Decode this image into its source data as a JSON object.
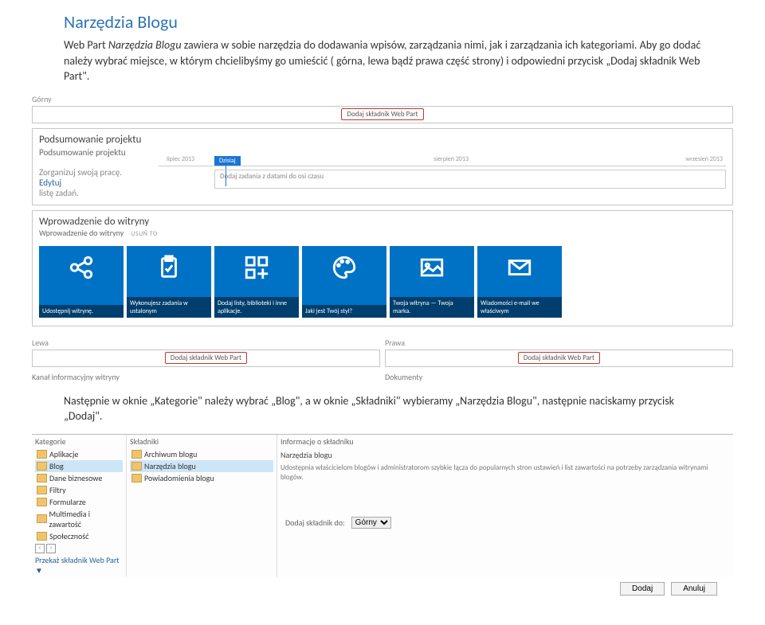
{
  "doc": {
    "title": "Narzędzia Blogu",
    "para1_a": "Web Part ",
    "para1_b": "Narzędzia Blogu",
    "para1_c": " zawiera w sobie narzędzia do dodawania wpisów, zarządzania nimi, jak i zarządzania ich kategoriami. Aby go dodać należy wybrać miejsce, w którym chcielibyśmy go umieścić ( górna, lewa bądź prawa część strony) i odpowiedni przycisk „Dodaj składnik Web Part\".",
    "para2": "Następnie w oknie „Kategorie\" należy wybrać „Blog\", a w oknie „Składniki\" wybieramy „Narzędzia Blogu\", następnie naciskamy przycisk „Dodaj\"."
  },
  "shot1": {
    "zoneTop": "Górny",
    "zoneLeft": "Lewa",
    "zoneRight": "Prawa",
    "addWp": "Dodaj składnik Web Part",
    "summaryTitle": "Podsumowanie projektu",
    "summarySub": "Podsumowanie projektu",
    "tl_organize": "Zorganizuj swoją pracę.",
    "tl_edit": "Edytuj",
    "tl_list": "listę zadań.",
    "tl_today": "Dzisiaj",
    "tl_m1": "lipiec 2013",
    "tl_m2": "sierpień 2013",
    "tl_m3": "wrzesień 2013",
    "tl_task": "Dodaj zadania z datami do osi czasu",
    "introTitle": "Wprowadzenie do witryny",
    "introSub": "Wprowadzenie do witryny",
    "introRemove": "USUŃ TO",
    "tiles": [
      "Udostępnij witrynę.",
      "Wykonujesz zadania w ustalonym",
      "Dodaj listy, biblioteki i inne aplikacje.",
      "Jaki jest Twój styl?",
      "Twoja witryna — Twoja marka.",
      "Wiadomości e-mail we właściwym"
    ],
    "feedLabel": "Kanał informacyjny witryny",
    "docsLabel": "Dokumenty"
  },
  "panel": {
    "catHeader": "Kategorie",
    "compHeader": "Składniki",
    "infoHeader": "Informacje o składniku",
    "categories": [
      "Aplikacje",
      "Blog",
      "Dane biznesowe",
      "Filtry",
      "Formularze",
      "Multimedia i zawartość",
      "Społeczność"
    ],
    "components": [
      "Archiwum blogu",
      "Narzędzia blogu",
      "Powiadomienia blogu"
    ],
    "infoTitle": "Narzędzia blogu",
    "infoDesc": "Udostępnia właścicielom blogów i administratorom szybkie łącza do popularnych stron ustawień i list zawartości na potrzeby zarządzania witrynami blogów.",
    "uploadLink": "Przekaż składnik Web Part ▼",
    "addTo": "Dodaj składnik do:",
    "addToValue": "Górny",
    "btnAdd": "Dodaj",
    "btnCancel": "Anuluj"
  }
}
